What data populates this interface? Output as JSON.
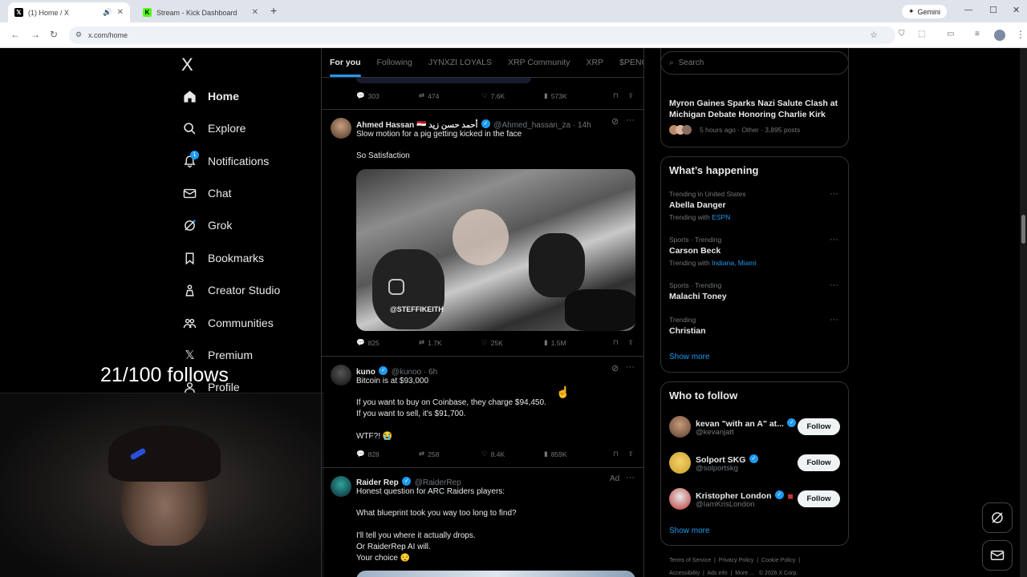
{
  "browser": {
    "tabs": [
      {
        "title": "(1) Home / X"
      },
      {
        "title": "Stream - Kick Dashboard"
      }
    ],
    "new_tab": "+",
    "gemini": "Gemini",
    "url": "x.com/home"
  },
  "nav": {
    "logo": "X",
    "items": [
      {
        "label": "Home",
        "icon": "home-icon"
      },
      {
        "label": "Explore",
        "icon": "search-icon"
      },
      {
        "label": "Notifications",
        "icon": "bell-icon",
        "badge": "1"
      },
      {
        "label": "Chat",
        "icon": "mail-icon"
      },
      {
        "label": "Grok",
        "icon": "grok-icon"
      },
      {
        "label": "Bookmarks",
        "icon": "bookmark-icon"
      },
      {
        "label": "Creator Studio",
        "icon": "creator-icon"
      },
      {
        "label": "Communities",
        "icon": "communities-icon"
      },
      {
        "label": "Premium",
        "icon": "x-icon"
      },
      {
        "label": "Profile",
        "icon": "profile-icon"
      }
    ]
  },
  "overlay": {
    "follow_counter": "21/100 follows"
  },
  "feed": {
    "tabs": [
      "For you",
      "Following",
      "JYNXZI LOYALS",
      "XRP Community",
      "XRP",
      "$PENG"
    ],
    "prev_actions": {
      "replies": "303",
      "reposts": "474",
      "likes": "7.6K",
      "views": "573K"
    },
    "tweets": [
      {
        "name": "Ahmed Hassan 🇪🇬 أحمد حسن زيد",
        "handle": "@Ahmed_hassan_za · 14h",
        "lines": [
          "Slow motion for a pig getting kicked in the face",
          "So Satisfaction"
        ],
        "media_watermark": "@STEFFIKEITH",
        "actions": {
          "replies": "825",
          "reposts": "1.7K",
          "likes": "25K",
          "views": "1.5M"
        }
      },
      {
        "name": "kuno",
        "handle": "@kunoo · 6h",
        "lines": [
          "Bitcoin is at $93,000",
          "If you want to buy on Coinbase, they charge $94,450.",
          "If you want to sell, it's $91,700.",
          "WTF?! 😭"
        ],
        "actions": {
          "replies": "828",
          "reposts": "258",
          "likes": "8.4K",
          "views": "859K"
        }
      },
      {
        "name": "Raider Rep",
        "handle": "@RaiderRep",
        "ad": "Ad",
        "lines": [
          "Honest question for ARC Raiders players:",
          "What blueprint took you way too long to find?",
          "I'll tell you where it actually drops.",
          "Or RaiderRep AI will.",
          "Your choice 😌"
        ]
      }
    ]
  },
  "right": {
    "search_placeholder": "Search",
    "news": {
      "title": "Myron Gaines Sparks Nazi Salute Clash at Michigan Debate Honoring Charlie Kirk",
      "meta": "5 hours ago · Other · 3,895 posts"
    },
    "happening": {
      "title": "What’s happening",
      "trends": [
        {
          "meta": "Trending in United States",
          "name": "Abella Danger",
          "with_prefix": "Trending with",
          "with": "ESPN"
        },
        {
          "meta": "Sports · Trending",
          "name": "Carson Beck",
          "with_prefix": "Trending with",
          "with": "Indiana, Miami"
        },
        {
          "meta": "Sports · Trending",
          "name": "Malachi Toney"
        },
        {
          "meta": "Trending",
          "name": "Christian"
        }
      ],
      "show_more": "Show more"
    },
    "who_to_follow": {
      "title": "Who to follow",
      "accounts": [
        {
          "name": "kevan \"with an A\" at...",
          "handle": "@kevanjatt",
          "button": "Follow"
        },
        {
          "name": "Solport SKG",
          "handle": "@solportskg",
          "button": "Follow"
        },
        {
          "name": "Kristopher London",
          "handle": "@IamKrisLondon",
          "button": "Follow"
        }
      ],
      "show_more": "Show more"
    },
    "footer": {
      "links1": [
        "Terms of Service",
        "Privacy Policy",
        "Cookie Policy"
      ],
      "links2": [
        "Accessibility",
        "Ads info",
        "More ...",
        "© 2026 X Corp."
      ]
    }
  },
  "colors": {
    "accent": "#1d9bf0",
    "background": "#000000",
    "border": "#2f3336",
    "muted": "#71767b"
  }
}
